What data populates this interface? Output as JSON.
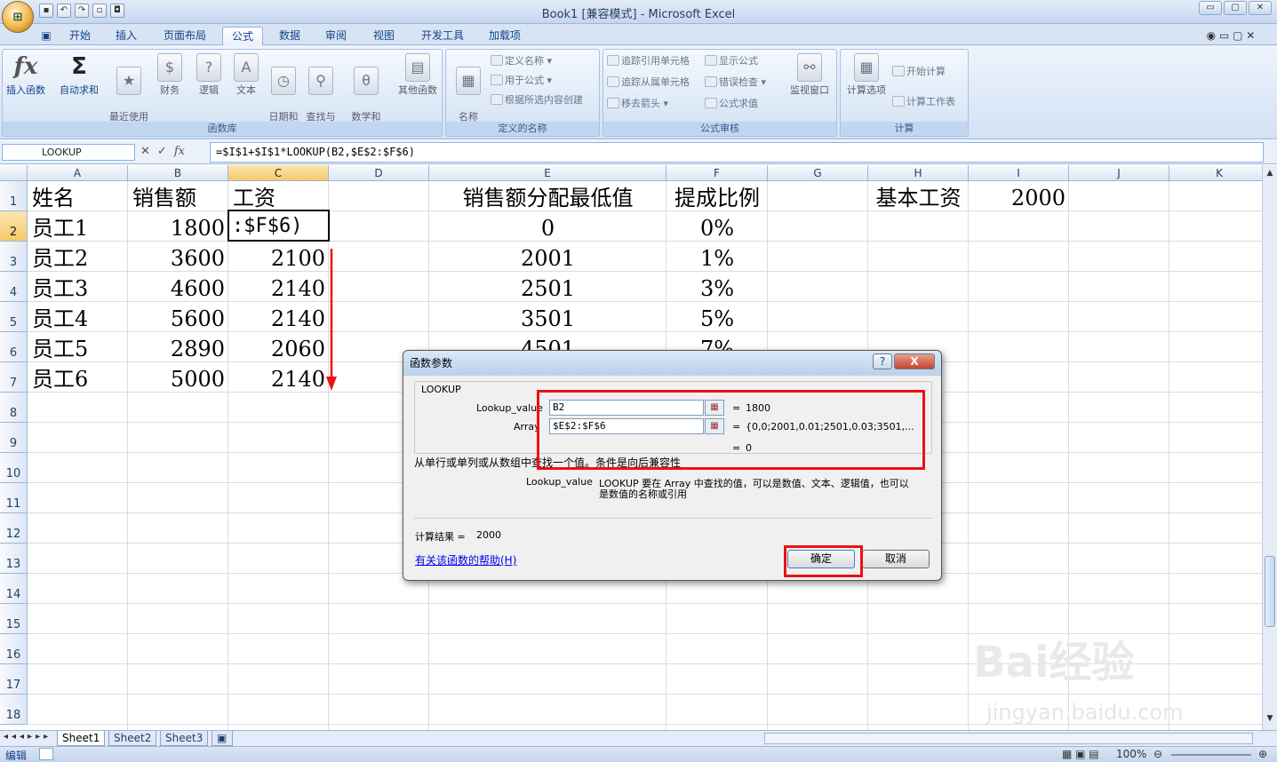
{
  "app": {
    "title": "Book1  [兼容模式] - Microsoft Excel",
    "window_buttons": [
      "▭",
      "▢",
      "✕"
    ]
  },
  "ribbon_tabs": [
    "开始",
    "插入",
    "页面布局",
    "公式",
    "数据",
    "审阅",
    "视图",
    "开发工具",
    "加载项"
  ],
  "active_tab": "公式",
  "ribbon": {
    "function_library": {
      "label": "函数库",
      "insert_function": "插入函数",
      "autosum": "自动求和",
      "recent": "最近使用\n的函数",
      "financial": "财务",
      "logical": "逻辑",
      "text": "文本",
      "datetime": "日期和\n时间",
      "lookup": "查找与\n引用",
      "math": "数学和\n三角函数",
      "more": "其他函数"
    },
    "defined_names": {
      "label": "定义的名称",
      "name_manager": "名称\n管理器",
      "define_name": "定义名称",
      "use_in_formula": "用于公式",
      "create_from_selection": "根据所选内容创建"
    },
    "auditing": {
      "label": "公式审核",
      "trace_precedents": "追踪引用单元格",
      "trace_dependents": "追踪从属单元格",
      "remove_arrows": "移去箭头",
      "show_formulas": "显示公式",
      "error_checking": "错误检查",
      "evaluate_formula": "公式求值",
      "watch_window": "监视窗口"
    },
    "calculation": {
      "label": "计算",
      "options": "计算选项",
      "calc_now": "开始计算",
      "calc_sheet": "计算工作表"
    }
  },
  "formula_bar": {
    "name_box": "LOOKUP",
    "formula": "=$I$1+$I$1*LOOKUP(B2,$E$2:$F$6)"
  },
  "columns": [
    "A",
    "B",
    "C",
    "D",
    "E",
    "F",
    "G",
    "H",
    "I",
    "J",
    "K"
  ],
  "rows": [
    "1",
    "2",
    "3",
    "4",
    "5",
    "6",
    "7",
    "8",
    "9",
    "10",
    "11",
    "12",
    "13",
    "14",
    "15",
    "16",
    "17",
    "18"
  ],
  "cells": {
    "A1": "姓名",
    "B1": "销售额",
    "C1": "工资",
    "E1": "销售额分配最低值",
    "F1": "提成比例",
    "H1": "基本工资",
    "I1": "2000",
    "A2": "员工1",
    "B2": "1800",
    "C2": ":$F$6)",
    "E2": "0",
    "F2": "0%",
    "A3": "员工2",
    "B3": "3600",
    "C3": "2100",
    "E3": "2001",
    "F3": "1%",
    "A4": "员工3",
    "B4": "4600",
    "C4": "2140",
    "E4": "2501",
    "F4": "3%",
    "A5": "员工4",
    "B5": "5600",
    "C5": "2140",
    "E5": "3501",
    "F5": "5%",
    "A6": "员工5",
    "B6": "2890",
    "C6": "2060",
    "E6": "4501",
    "F6": "7%",
    "A7": "员工6",
    "B7": "5000",
    "C7": "2140"
  },
  "sheets": [
    "Sheet1",
    "Sheet2",
    "Sheet3"
  ],
  "status": {
    "mode": "编辑",
    "zoom": "100%"
  },
  "dialog": {
    "title": "函数参数",
    "function_name": "LOOKUP",
    "args": [
      {
        "label": "Lookup_value",
        "value": "B2",
        "result": "1800"
      },
      {
        "label": "Array",
        "value": "$E$2:$F$6",
        "result": "{0,0;2001,0.01;2501,0.03;3501,..."
      }
    ],
    "overall_result": "0",
    "description": "从单行或单列或从数组中查找一个值。条件是向后兼容性",
    "arg_help_name": "Lookup_value",
    "arg_help_line1": "LOOKUP 要在 Array 中查找的值，可以是数值、文本、逻辑值，也可以",
    "arg_help_line2": "是数值的名称或引用",
    "calc_result_label": "计算结果 =",
    "calc_result_value": "2000",
    "help_link": "有关该函数的帮助(H)",
    "ok": "确定",
    "cancel": "取消",
    "help_btn": "?",
    "close_btn": "X",
    "equals": "="
  },
  "watermark": {
    "brand": "Bai经验",
    "url": "jingyan.baidu.com"
  },
  "colors": {
    "accent_red": "#ee1111",
    "selected_header": "#f6c96b",
    "ribbon_blue": "#15428b"
  }
}
